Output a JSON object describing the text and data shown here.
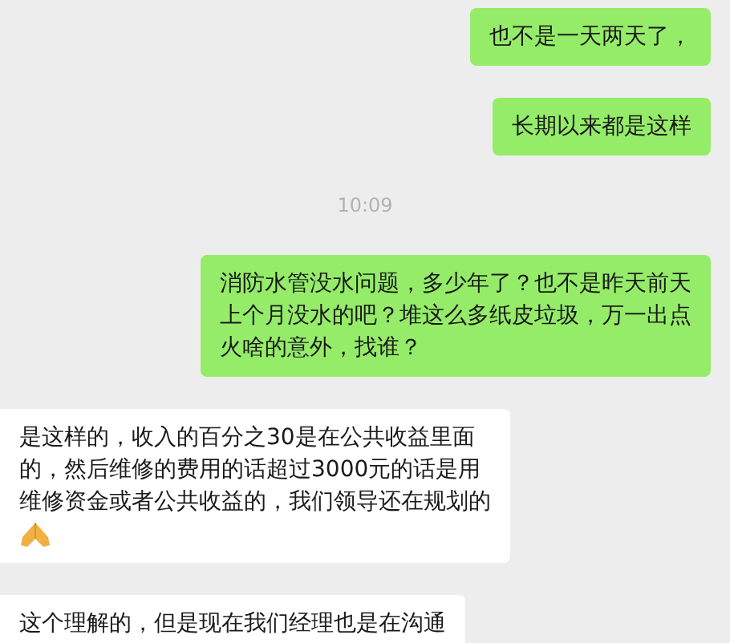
{
  "messages": [
    {
      "kind": "bubble",
      "outgoing": true,
      "text": "也不是一天两天了，"
    },
    {
      "kind": "bubble",
      "outgoing": true,
      "text": "长期以来都是这样"
    },
    {
      "kind": "time",
      "text": "10:09"
    },
    {
      "kind": "bubble",
      "outgoing": true,
      "text": "消防水管没水问题，多少年了？也不是昨天前天上个月没水的吧？堆这么多纸皮垃圾，万一出点火啥的意外，找谁？"
    },
    {
      "kind": "bubble",
      "outgoing": false,
      "text": "是这样的，收入的百分之30是在公共收益里面的，然后维修的费用的话超过3000元的话是用维修资金或者公共收益的，我们领导还在规划的",
      "emoji": true
    },
    {
      "kind": "bubble",
      "outgoing": false,
      "text": "这个理解的，但是现在我们经理也是在沟通"
    }
  ]
}
